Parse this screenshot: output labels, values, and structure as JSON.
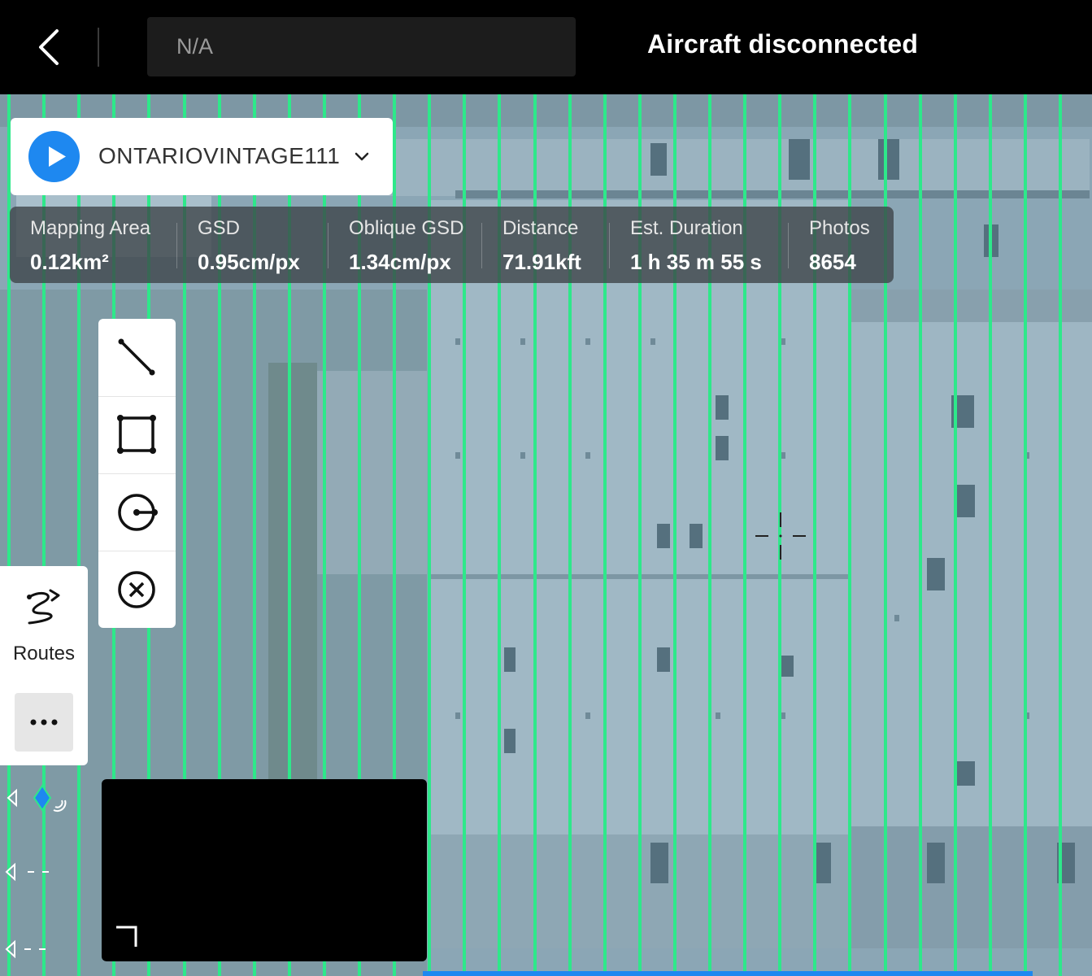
{
  "header": {
    "mission_name_value": "N/A",
    "status": "Aircraft disconnected"
  },
  "mission": {
    "name": "ONTARIOVINTAGE111"
  },
  "stats": [
    {
      "label": "Mapping Area",
      "value": "0.12km²"
    },
    {
      "label": "GSD",
      "value": "0.95cm/px"
    },
    {
      "label": "Oblique GSD",
      "value": "1.34cm/px"
    },
    {
      "label": "Distance",
      "value": "71.91kft"
    },
    {
      "label": "Est. Duration",
      "value": "1 h 35 m 55 s"
    },
    {
      "label": "Photos",
      "value": "8654"
    }
  ],
  "toolbar": {
    "tools": [
      "line-tool-icon",
      "rectangle-tool-icon",
      "circle-tool-icon",
      "clear-icon"
    ]
  },
  "sidebar": {
    "routes_label": "Routes"
  },
  "colors": {
    "accent": "#1e88f0",
    "flight_line": "#2ee88a",
    "topbar": "#000000"
  }
}
